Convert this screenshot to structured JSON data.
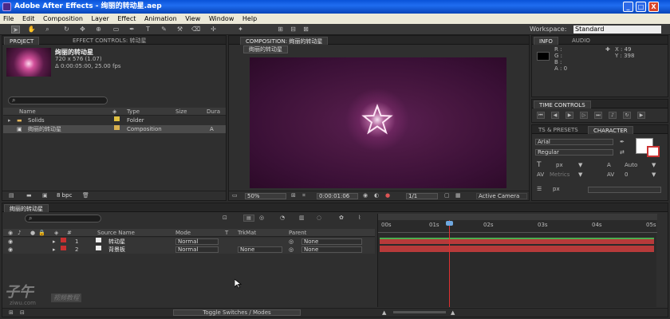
{
  "window": {
    "title": "Adobe After Effects - 绚丽的转动星.aep",
    "minimize": "_",
    "maximize": "□",
    "close": "X"
  },
  "menu": [
    "File",
    "Edit",
    "Composition",
    "Layer",
    "Effect",
    "Animation",
    "View",
    "Window",
    "Help"
  ],
  "toolbar": {
    "workspace_label": "Workspace:",
    "workspace_value": "Standard"
  },
  "project": {
    "tabs": [
      "PROJECT",
      "EFFECT CONTROLS: 转动星"
    ],
    "comp_name": "绚丽的转动星",
    "size_line": "720 x 576 (1.07)",
    "duration_line": "Δ 0:00:05:00, 25.00 fps",
    "columns": [
      "Name",
      "Type",
      "Size",
      "Dura"
    ],
    "items": [
      {
        "name": "Solids",
        "type": "Folder",
        "size": "",
        "extra": ""
      },
      {
        "name": "绚丽的转动星",
        "type": "Composition",
        "size": "",
        "extra": "A"
      }
    ],
    "bpc": "8 bpc"
  },
  "composition": {
    "tab": "COMPOSITION: 绚丽的转动星",
    "subtab": "绚丽的转动星",
    "zoom": "50%",
    "timecode": "0:00:01:06",
    "resolution": "1/1",
    "camera": "Active Camera"
  },
  "info": {
    "tabs": [
      "INFO",
      "AUDIO"
    ],
    "r": "R :",
    "g": "G :",
    "b": "B :",
    "a": "A : 0",
    "x": "X : 49",
    "y": "Y : 398"
  },
  "time_controls": {
    "tab": "TIME CONTROLS"
  },
  "character": {
    "tabs": [
      "TS & PRESETS",
      "CHARACTER"
    ],
    "font": "Arial",
    "style": "Regular",
    "size_unit": "px",
    "leading": "Auto",
    "metrics": "Metrics",
    "tracking": "0",
    "indent_unit": "px"
  },
  "timeline": {
    "tab": "绚丽的转动星",
    "columns": {
      "source_name": "Source Name",
      "mode": "Mode",
      "t": "T",
      "trkmat": "TrkMat",
      "parent": "Parent"
    },
    "layers": [
      {
        "num": "1",
        "name": "转动星",
        "mode": "Normal",
        "trkmat": "",
        "parent": "None"
      },
      {
        "num": "2",
        "name": "背景板",
        "mode": "Normal",
        "trkmat": "None",
        "parent": "None"
      }
    ],
    "ruler": [
      "00s",
      "01s",
      "02s",
      "03s",
      "04s",
      "05s"
    ],
    "toggle_label": "Toggle Switches / Modes",
    "colors": {
      "layer_bar": "#b73a3a",
      "playhead": "#e03030",
      "label_red": "#c83030"
    }
  },
  "watermark": {
    "text1": "子午",
    "text2": "视频教程",
    "text3": "ziwu.com"
  }
}
